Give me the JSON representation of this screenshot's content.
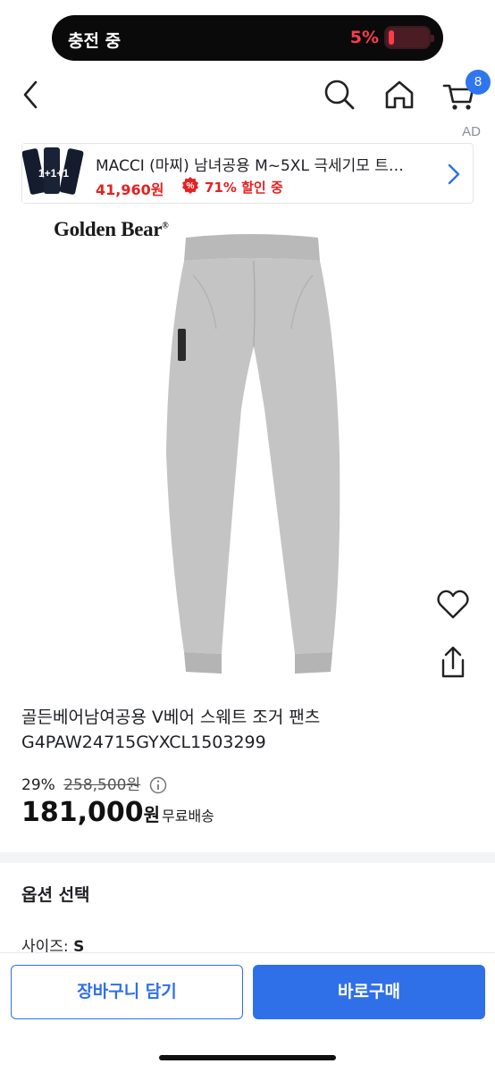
{
  "status_bar": {
    "charging_text": "충전 중",
    "battery_percent": "5%",
    "battery_level": 0.05
  },
  "header": {
    "cart_count": "8",
    "icons": [
      "back-chevron-icon",
      "search-icon",
      "home-icon",
      "cart-icon"
    ]
  },
  "ad": {
    "label": "AD",
    "thumb_text": "1+1+1",
    "title": "MACCI (마찌) 남녀공용 M~5XL 극세기모 트…",
    "price": "41,960원",
    "discount": "71% 할인 중",
    "discount_icon": "%"
  },
  "product": {
    "brand": "Golden Bear",
    "brand_mark": "®",
    "title_line1": "골든베어남여공용 V베어 스웨트 조거 팬츠",
    "title_line2": "G4PAW24715GYXCL1503299",
    "discount_rate": "29%",
    "original_price": "258,500원",
    "sale_price_number": "181,000",
    "sale_price_unit": "원",
    "shipping": "무료배송"
  },
  "options": {
    "header": "옵션 선택",
    "size_label": "사이즈:",
    "size_value": "S"
  },
  "bottom_bar": {
    "cart_button": "장바구니 담기",
    "buy_button": "바로구매"
  },
  "colors": {
    "accent": "#2f6fe8",
    "badge": "#2f76ee",
    "sale_red": "#e42121",
    "battery_red": "#ff3b4a"
  }
}
